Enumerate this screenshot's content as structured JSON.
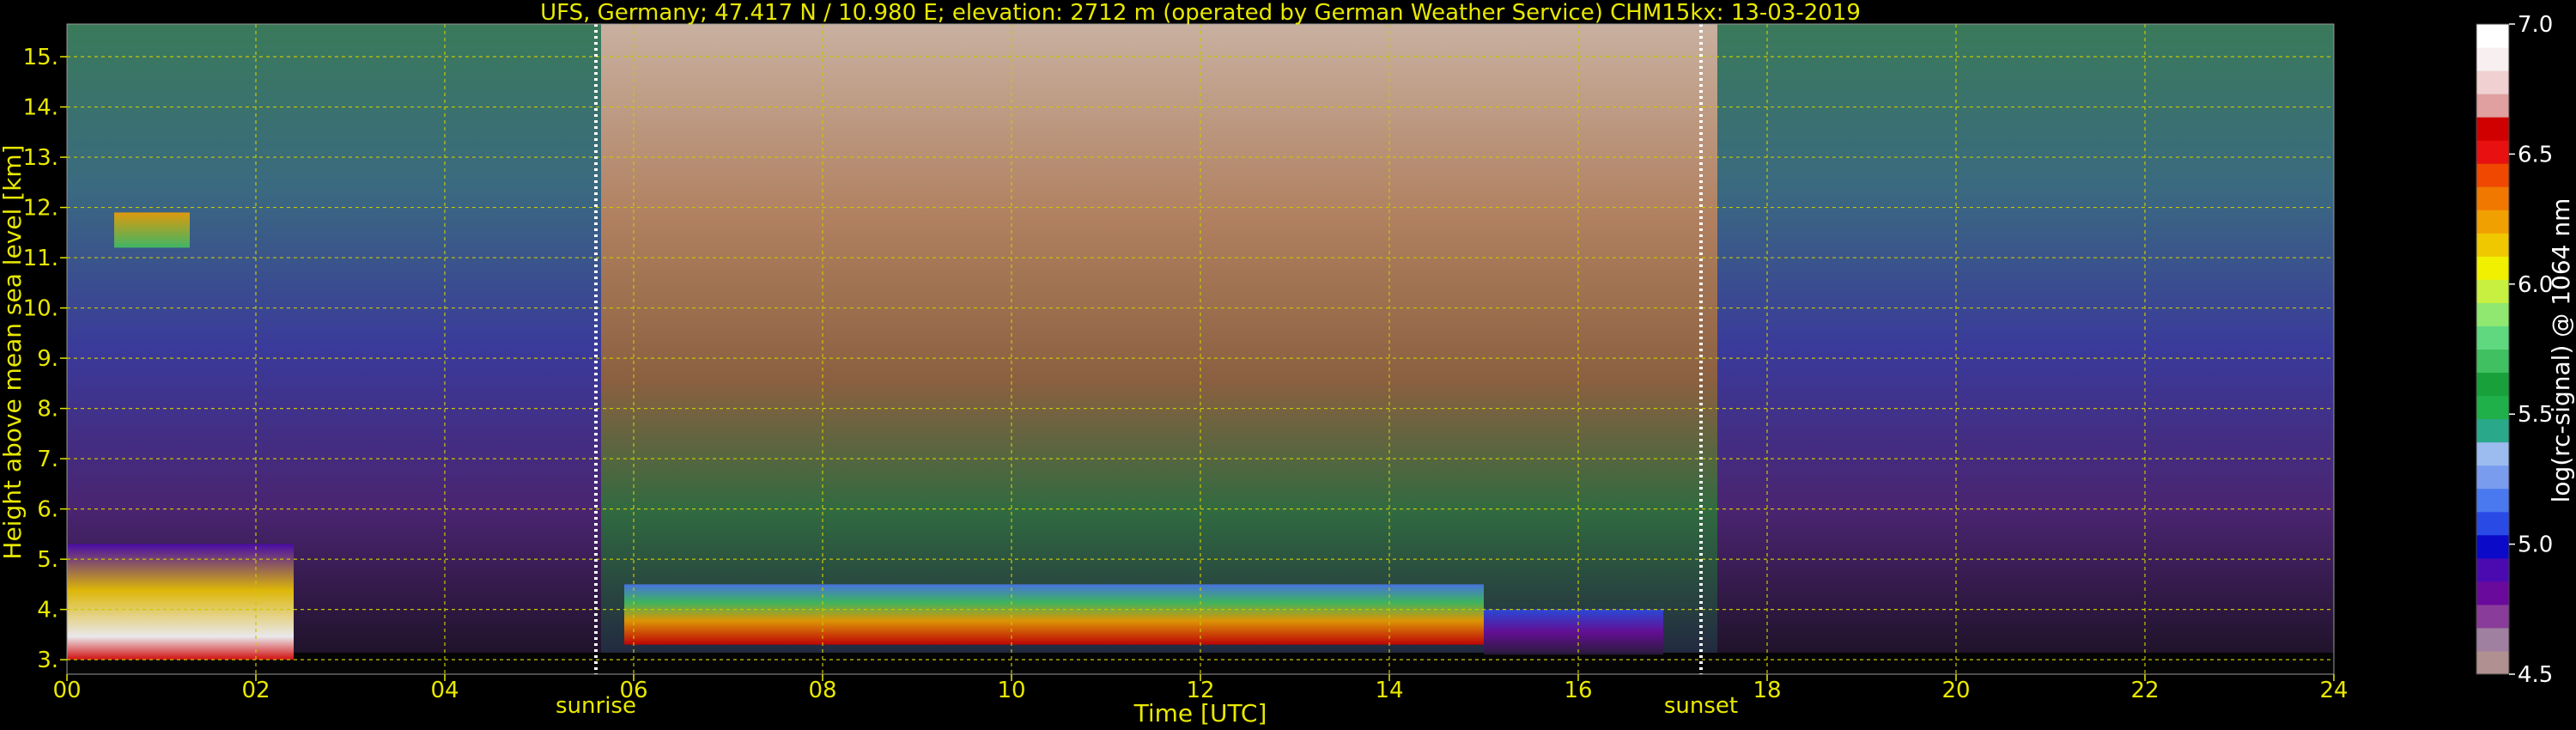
{
  "chart_data": {
    "type": "heatmap",
    "title": "UFS, Germany; 47.417 N / 10.980 E; elevation: 2712 m  (operated by German Weather Service)    CHM15kx: 13-03-2019",
    "xlabel": "Time [UTC]",
    "ylabel": "Height above mean sea level [km]",
    "xlim": [
      0,
      24
    ],
    "ylim": [
      2.712,
      15.65
    ],
    "xticks": [
      0,
      2,
      4,
      6,
      8,
      10,
      12,
      14,
      16,
      18,
      20,
      22,
      24
    ],
    "xtick_labels": [
      "00",
      "02",
      "04",
      "06",
      "08",
      "10",
      "12",
      "14",
      "16",
      "18",
      "20",
      "22",
      "24"
    ],
    "yticks": [
      3,
      4,
      5,
      6,
      7,
      8,
      9,
      10,
      11,
      12,
      13,
      14,
      15
    ],
    "ytick_labels": [
      "3.",
      "4.",
      "5.",
      "6.",
      "7.",
      "8.",
      "9.",
      "10.",
      "11.",
      "12.",
      "13.",
      "14.",
      "15."
    ],
    "grid": true,
    "markers": [
      {
        "label": "sunrise",
        "x": 5.6
      },
      {
        "label": "sunset",
        "x": 17.3
      }
    ],
    "colorbar": {
      "label": "log(rc-signal) @ 1064 nm",
      "range": [
        4.5,
        7.0
      ],
      "ticks": [
        4.5,
        5.0,
        5.5,
        6.0,
        6.5,
        7.0
      ],
      "tick_labels": [
        "4.5",
        "5.0",
        "5.5",
        "6.0",
        "6.5",
        "7.0"
      ],
      "colors": [
        "#b09090",
        "#a080a0",
        "#8a3c9a",
        "#6a0a9c",
        "#4a0ab0",
        "#0a0ac8",
        "#2a4ae6",
        "#4a78ee",
        "#7a9cee",
        "#9cbcf0",
        "#2aa88a",
        "#20b04a",
        "#18a03a",
        "#40c060",
        "#60d880",
        "#90e870",
        "#c8f040",
        "#f0f000",
        "#f0c800",
        "#f0a000",
        "#f07800",
        "#f04800",
        "#e81010",
        "#d00000",
        "#e0a0a0",
        "#f0d0d0",
        "#f8f0f0",
        "#ffffff"
      ]
    },
    "layers": [
      {
        "name": "cloud layer",
        "x": [
          0.0,
          2.4
        ],
        "y": [
          3.0,
          5.3
        ]
      },
      {
        "name": "cloud layer",
        "x": [
          5.9,
          15.0
        ],
        "y": [
          3.3,
          4.5
        ]
      },
      {
        "name": "cloud layer",
        "x": [
          15.0,
          16.9
        ],
        "y": [
          3.1,
          4.0
        ]
      },
      {
        "name": "cirrus",
        "x": [
          0.5,
          1.3
        ],
        "y": [
          11.2,
          11.9
        ]
      }
    ]
  }
}
